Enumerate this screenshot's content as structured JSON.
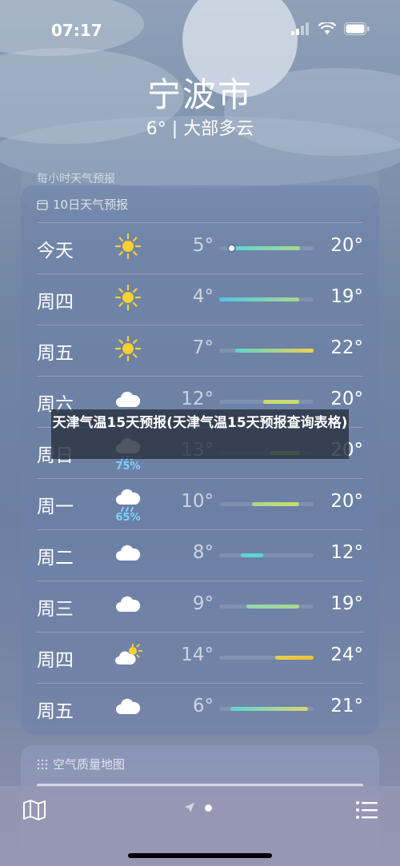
{
  "status": {
    "time": "07:17"
  },
  "header": {
    "city": "宁波市",
    "summary": "6° | 大部多云"
  },
  "hourly_card": {
    "title": "每小时天气预报"
  },
  "forecast": {
    "title": "10日天气预报",
    "days": [
      {
        "day": "今天",
        "icon": "sun-icon",
        "low": "5°",
        "high": "20°",
        "bar_start": 0.1,
        "bar_end": 0.85,
        "current": 0.13,
        "colors": [
          "#5ad6d6",
          "#a8d890"
        ]
      },
      {
        "day": "周四",
        "icon": "sun-icon",
        "low": "4°",
        "high": "19°",
        "bar_start": 0.0,
        "bar_end": 0.85,
        "colors": [
          "#4fc7e6",
          "#a8d890"
        ]
      },
      {
        "day": "周五",
        "icon": "sun-icon",
        "low": "7°",
        "high": "22°",
        "bar_start": 0.17,
        "bar_end": 1.0,
        "colors": [
          "#5ad6c6",
          "#f0d050"
        ]
      },
      {
        "day": "周六",
        "icon": "cloud-icon",
        "low": "12°",
        "high": "20°",
        "bar_start": 0.47,
        "bar_end": 0.85,
        "colors": [
          "#c8dd70",
          "#c8dd70"
        ]
      },
      {
        "day": "周日",
        "icon": "cloud-rain-icon",
        "precip": "75%",
        "low": "13°",
        "high": "20°",
        "bar_start": 0.53,
        "bar_end": 0.85,
        "colors": [
          "#c8dd70",
          "#c8dd70"
        ]
      },
      {
        "day": "周一",
        "icon": "cloud-rain-icon",
        "precip": "65%",
        "low": "10°",
        "high": "20°",
        "bar_start": 0.35,
        "bar_end": 0.85,
        "colors": [
          "#a8d890",
          "#c8dd70"
        ]
      },
      {
        "day": "周二",
        "icon": "cloud-icon",
        "low": "8°",
        "high": "12°",
        "bar_start": 0.23,
        "bar_end": 0.47,
        "colors": [
          "#5ad6d6",
          "#5ad6d6"
        ]
      },
      {
        "day": "周三",
        "icon": "cloud-icon",
        "low": "9°",
        "high": "19°",
        "bar_start": 0.29,
        "bar_end": 0.85,
        "colors": [
          "#90d6b0",
          "#a8d890"
        ]
      },
      {
        "day": "周四",
        "icon": "cloud-sun-icon",
        "low": "14°",
        "high": "24°",
        "bar_start": 0.59,
        "bar_end": 1.0,
        "colors": [
          "#e6d050",
          "#f0c030"
        ]
      },
      {
        "day": "周五",
        "icon": "cloud-icon",
        "low": "6°",
        "high": "21°",
        "bar_start": 0.12,
        "bar_end": 0.94,
        "colors": [
          "#5ad6d6",
          "#d8d870"
        ]
      }
    ]
  },
  "overlay": {
    "text": "天津气温15天预报(天津气温15天预报查询表格)"
  },
  "air_quality": {
    "title": "空气质量地图"
  }
}
